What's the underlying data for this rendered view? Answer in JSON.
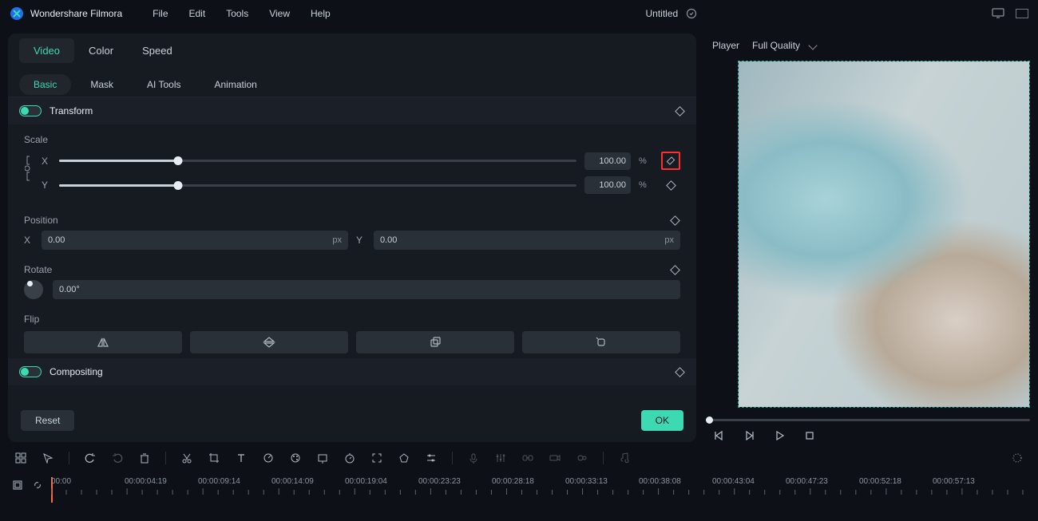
{
  "app": {
    "title": "Wondershare Filmora",
    "doc_title": "Untitled"
  },
  "menu": {
    "file": "File",
    "edit": "Edit",
    "tools": "Tools",
    "view": "View",
    "help": "Help"
  },
  "tabs": {
    "video": "Video",
    "color": "Color",
    "speed": "Speed"
  },
  "subtabs": {
    "basic": "Basic",
    "mask": "Mask",
    "ai": "AI Tools",
    "animation": "Animation"
  },
  "sections": {
    "transform": "Transform",
    "scale": "Scale",
    "position": "Position",
    "rotate": "Rotate",
    "flip": "Flip",
    "compositing": "Compositing"
  },
  "scale": {
    "x_label": "X",
    "x_value": "100.00",
    "x_unit": "%",
    "y_label": "Y",
    "y_value": "100.00",
    "y_unit": "%"
  },
  "position": {
    "x_label": "X",
    "x_value": "0.00",
    "x_unit": "px",
    "y_label": "Y",
    "y_value": "0.00",
    "y_unit": "px"
  },
  "rotate": {
    "value": "0.00°"
  },
  "buttons": {
    "reset": "Reset",
    "ok": "OK"
  },
  "player": {
    "label": "Player",
    "quality": "Full Quality"
  },
  "timeline": {
    "labels": [
      "00:00",
      "00:00:04:19",
      "00:00:09:14",
      "00:00:14:09",
      "00:00:19:04",
      "00:00:23:23",
      "00:00:28:18",
      "00:00:33:13",
      "00:00:38:08",
      "00:00:43:04",
      "00:00:47:23",
      "00:00:52:18",
      "00:00:57:13"
    ]
  }
}
